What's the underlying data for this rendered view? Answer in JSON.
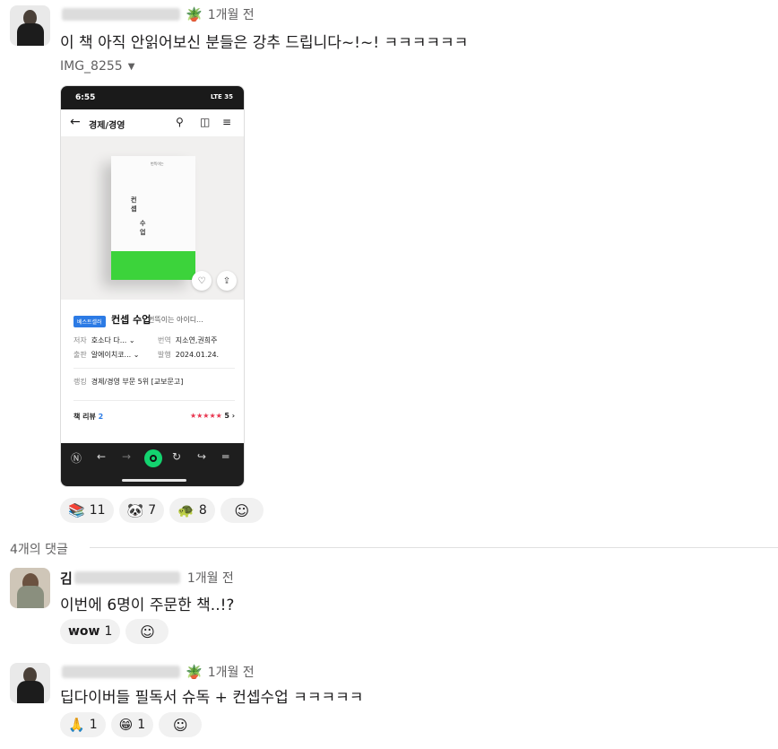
{
  "post": {
    "author_initial": "",
    "time": "1개월 전",
    "text": "이 책 아직 안읽어보신 분들은 강추 드립니다~!~! ㅋㅋㅋㅋㅋㅋ",
    "file_name": "IMG_8255",
    "reactions": [
      {
        "icon": "books-emoji",
        "emoji": "📚",
        "count": "11"
      },
      {
        "icon": "panda-emoji",
        "emoji": "🐼",
        "count": "7"
      },
      {
        "icon": "turtle-emoji",
        "emoji": "🐢",
        "count": "8"
      }
    ]
  },
  "screenshot": {
    "status_time": "6:55",
    "status_right": "LTE 35",
    "nav_title": "경제/경영",
    "book_author_small": "번뜩이는",
    "book_cover_title1": "컨",
    "book_cover_title2": "셉",
    "book_cover_title3": "수",
    "book_cover_title4": "업",
    "badge": "베스트셀러",
    "book_title": "컨셉 수업",
    "book_subtitle": "번뜩이는 아이디...",
    "author_label": "저자",
    "author_value": "호소다 다...",
    "translator_label": "번역",
    "translator_value": "지소연,권희주",
    "publisher_label": "출판",
    "publisher_value": "알에이치코...",
    "date_label": "발행",
    "date_value": "2024.01.24.",
    "ranking_label": "랭킹",
    "ranking_value": "경제/경영 부문 5위 [교보문고]",
    "review_label": "책 리뷰",
    "review_count": "2",
    "stars": "★★★★★",
    "rating": "5 ›"
  },
  "thread": {
    "replies_label": "4개의 댓글"
  },
  "comments": [
    {
      "author_initial": "김",
      "time": "1개월 전",
      "text": "이번에 6명이 주문한 책..!?",
      "reactions": [
        {
          "icon": "wow-emoji",
          "emoji": "wow",
          "count": "1"
        }
      ]
    },
    {
      "author_initial": "",
      "time": "1개월 전",
      "text": "딥다이버들 필독서 슈독 + 컨셉수업 ㅋㅋㅋㅋㅋ",
      "reactions": [
        {
          "icon": "pray-emoji",
          "emoji": "🙏",
          "count": "1"
        },
        {
          "icon": "grin-emoji",
          "emoji": "😁",
          "count": "1"
        }
      ]
    }
  ],
  "colors": {
    "accent_green": "#13d36f",
    "badge_blue": "#2c7be5",
    "star_red": "#e8344e"
  }
}
